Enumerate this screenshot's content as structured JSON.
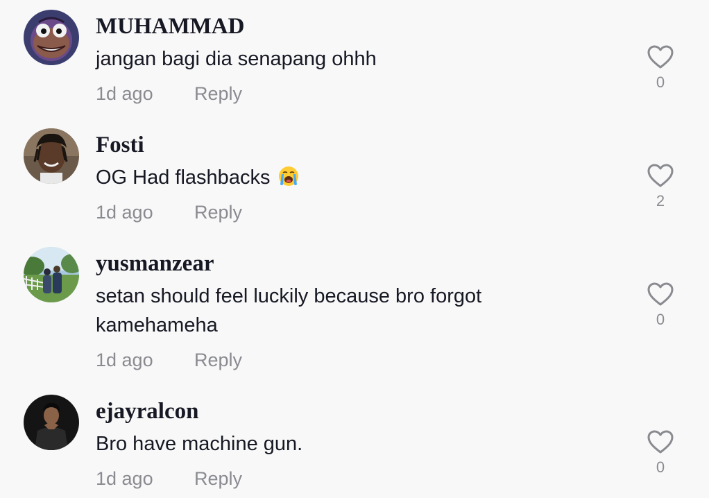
{
  "comments": [
    {
      "username": "MUHAMMAD",
      "text": "jangan bagi dia senapang ohhh",
      "time": "1d ago",
      "reply_label": "Reply",
      "likes": "0",
      "avatar_icon": "cartoon-face-avatar"
    },
    {
      "username": "Fosti",
      "text": "OG Had flashbacks",
      "emoji_icon": "loudly-crying-face-emoji",
      "time": "1d ago",
      "reply_label": "Reply",
      "likes": "2",
      "avatar_icon": "person-photo-avatar"
    },
    {
      "username": "yusmanzear",
      "text": "setan should feel luckily because bro forgot kamehameha",
      "time": "1d ago",
      "reply_label": "Reply",
      "likes": "0",
      "avatar_icon": "couple-photo-avatar"
    },
    {
      "username": "ejayralcon",
      "text": "Bro have machine gun.",
      "time": "1d ago",
      "reply_label": "Reply",
      "likes": "0",
      "avatar_icon": "person-photo-avatar"
    }
  ],
  "colors": {
    "background": "#f8f8f8",
    "primary_text": "#161823",
    "secondary_text": "#8a8b91",
    "heart_outline": "#8a8b91"
  }
}
